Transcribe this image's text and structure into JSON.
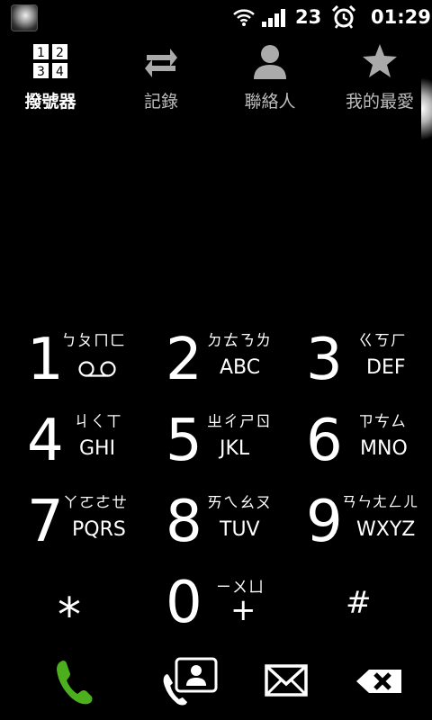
{
  "status": {
    "battery_level": "23",
    "time": "01:29",
    "icons": [
      "avatar-icon",
      "wifi-icon",
      "signal-icon",
      "alarm-icon"
    ]
  },
  "tabs": [
    {
      "label": "撥號器",
      "icon": "dialpad-icon",
      "active": true
    },
    {
      "label": "記錄",
      "icon": "call-log-icon",
      "active": false
    },
    {
      "label": "聯絡人",
      "icon": "contact-icon",
      "active": false
    },
    {
      "label": "我的最愛",
      "icon": "star-icon",
      "active": false
    }
  ],
  "keypad": [
    {
      "digit": "1",
      "bopomofo": "ㄅㄆㄇㄈ",
      "letters": ""
    },
    {
      "digit": "2",
      "bopomofo": "ㄉㄊㄋㄌ",
      "letters": "ABC"
    },
    {
      "digit": "3",
      "bopomofo": "ㄍㄎㄏ",
      "letters": "DEF"
    },
    {
      "digit": "4",
      "bopomofo": "ㄐㄑㄒ",
      "letters": "GHI"
    },
    {
      "digit": "5",
      "bopomofo": "ㄓㄔㄕㄖ",
      "letters": "JKL"
    },
    {
      "digit": "6",
      "bopomofo": "ㄗㄘㄙ",
      "letters": "MNO"
    },
    {
      "digit": "7",
      "bopomofo": "ㄚㄛㄜㄝ",
      "letters": "PQRS"
    },
    {
      "digit": "8",
      "bopomofo": "ㄞㄟㄠㄡ",
      "letters": "TUV"
    },
    {
      "digit": "9",
      "bopomofo": "ㄢㄣㄤㄥㄦ",
      "letters": "WXYZ"
    },
    {
      "digit": "*",
      "bopomofo": "",
      "letters": ""
    },
    {
      "digit": "0",
      "bopomofo": "ㄧㄨㄩ",
      "letters": "+"
    },
    {
      "digit": "#",
      "bopomofo": "",
      "letters": ""
    }
  ],
  "bottom": {
    "icons": [
      "call-icon",
      "contacts-card-icon",
      "message-icon",
      "backspace-icon"
    ],
    "call_color": "#4caf1e"
  }
}
